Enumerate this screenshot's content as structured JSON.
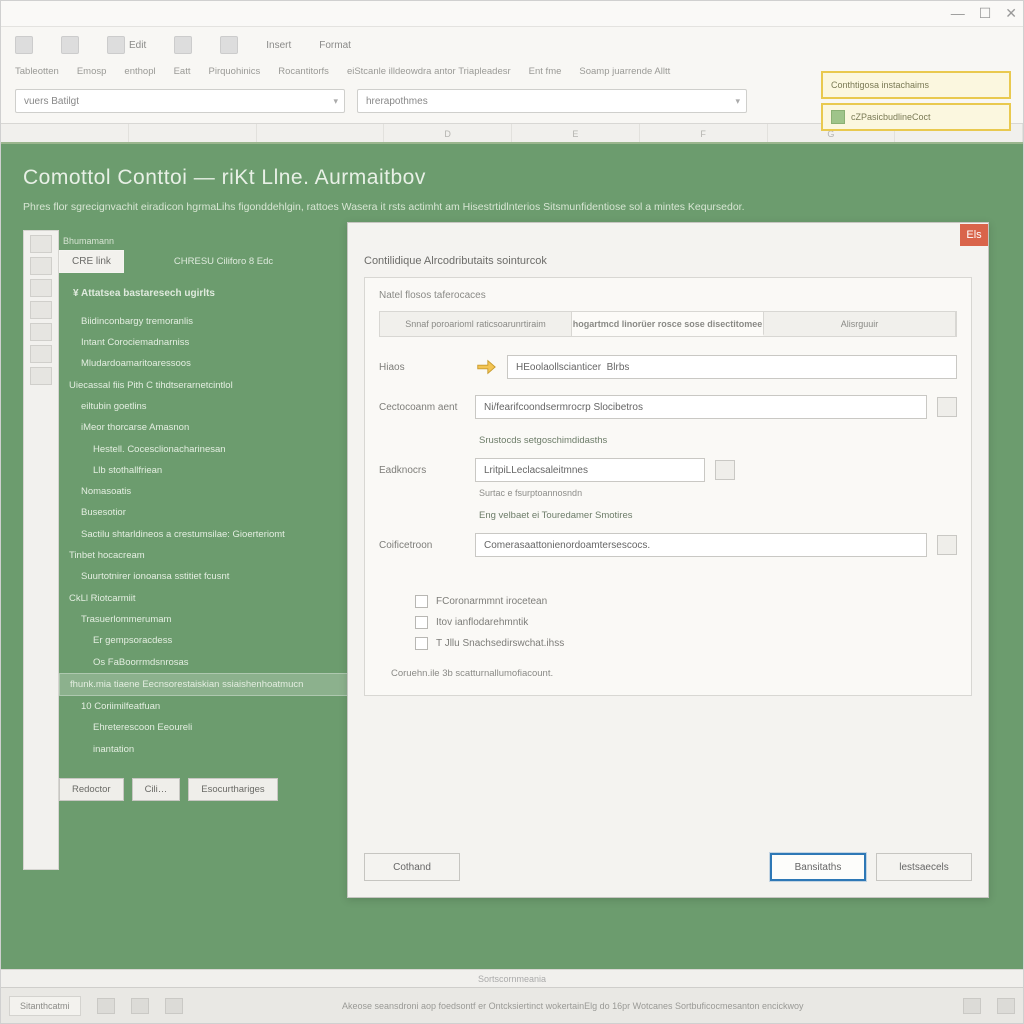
{
  "window": {
    "min": "—",
    "max": "☐",
    "close": "✕"
  },
  "ribbon": {
    "row1": [
      "Edit",
      "Insert",
      "Format"
    ],
    "row2": [
      "Tableotten",
      "Emosp",
      "enthopl",
      "Eatt",
      "Pirquohinics",
      "Rocantitorfs",
      "eiStcanle illdeowdra antor Triapleadesr",
      "Ent fme",
      "Soamp juarrende Alltt"
    ],
    "dd1": "vuers Batilgt",
    "dd2": "hrerapothmes",
    "hi1": "Conthtigosa instachaims",
    "hi2": "cZPasicbudlineCoct"
  },
  "cols": [
    "",
    "",
    "",
    "D",
    "E",
    "F",
    "G",
    ""
  ],
  "green": {
    "title": "Comottol Conttoi — riKt Llne. Aurmaitbov",
    "sub": "Phres flor sgrecignvachit eiradicon hgrmaLihs figonddehlgin, rattoes Wasera it rsts actimht am Hisestrtidlnterios Sitsmunfidentiose sol a mintes Keqursedor.",
    "tabs": {
      "summary": "Bhumamann",
      "active": "CRE link",
      "activeRight": "CHRESU Ciliforo 8 Edc"
    },
    "tree": [
      "¥ Attatsea bastaresech ugirlts",
      "Biidinconbargy tremoranlis",
      "Intant Corociemadnarniss",
      "Mludardoamaritoaressoos",
      "Uiecassal fiis Pith C tihdtserarnetcintlol",
      "eiltubin goetlins",
      "iMeor thorcarse Amasnon",
      "Hestell. Cocesclionacharinesan",
      "Llb stothallfriean",
      "Nomasoatis",
      "Busesotior",
      "Sactilu shtarldineos a crestumsilae: Gioerteriomt",
      "Tinbet hocacream",
      "Suurtotnirer ionoansa sstitiet fcusnt",
      "CkLl Riotcarmiit",
      "Trasuerlommerumam",
      "Er gempsoracdess",
      "Os FaBoorrmdsnrosas",
      "fhunk.mia tiaene Eecnsorestaiskian ssiaishenhoatmucn",
      "10  Coriimilfeatfuan",
      "Ehreterescoon Eeoureli",
      "inantation"
    ],
    "btn_a": "Redoctor",
    "btn_b": "Cili…",
    "btn_c": "Esocurthariges"
  },
  "dialog": {
    "close": "Els",
    "heading": "Contilidique Alrcodributaits sointurcok",
    "group": "Natel flosos taferocaces",
    "tabs": [
      "Snnaf poroarioml raticsoarunrtiraim",
      "hogartmcd linorüer rosce sose disectitomee",
      "Alisrguuir"
    ],
    "activeTab": 1,
    "f_name_label": "Hiaos",
    "f_name_value": "HEoolaollscianticer  Blrbs",
    "f_cat_label": "Cectocoanm aent",
    "f_cat_value": "Ni/fearifcoondsermrocrp Slocibetros",
    "f_sched_hint": "Srustocds setgoschimdidasths",
    "f_cal_label": "Eadknocrs",
    "f_cal_value": "LritpiLLeclacsaleitmnes",
    "f_cal_hint": "Surtac e fsurptoannosndn",
    "f_link": "Eng velbaet ei Touredamer Smotires",
    "f_coll_label": "Coificetroon",
    "f_coll_value": "Comerasaattonienordoamtersescocs.",
    "cb1": "FCoronarmmnt irocetean",
    "cb2": "Itov ianflodarehmntik",
    "cb3": "T Jllu Snachsedirswchat.ihss",
    "note": "Coruehn.ile 3b scatturnallumofiacount.",
    "btn_cancel": "Cothand",
    "btn_ok": "Bansitaths",
    "btn_help": "lestsaecels"
  },
  "status": "Sortscornmeania",
  "taskbar": {
    "start": "Sitanthcatmi",
    "center": "Akeose seansdroni aop foedsontf er Ontcksiertinct wokertainElg do 16pr Wotcanes Sortbuficocmesanton encickwoy"
  }
}
